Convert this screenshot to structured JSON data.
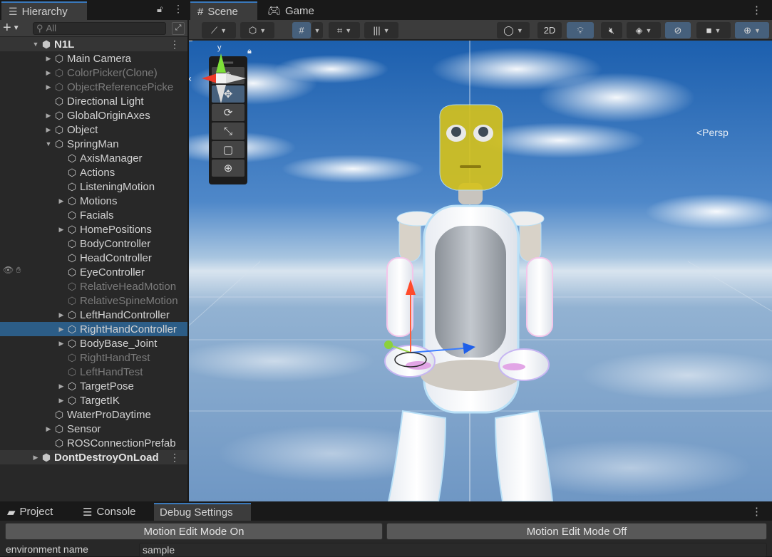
{
  "hierarchy": {
    "tab_label": "Hierarchy",
    "search_placeholder": "All",
    "add_label": "+",
    "rows": [
      {
        "label": "N1L",
        "type": "scene"
      },
      {
        "label": "Main Camera"
      },
      {
        "label": "ColorPicker(Clone)",
        "disabled": true
      },
      {
        "label": "ObjectReferencePicke",
        "disabled": true
      },
      {
        "label": "Directional Light"
      },
      {
        "label": "GlobalOriginAxes"
      },
      {
        "label": "Object"
      },
      {
        "label": "SpringMan"
      },
      {
        "label": "AxisManager"
      },
      {
        "label": "Actions"
      },
      {
        "label": "ListeningMotion"
      },
      {
        "label": "Motions"
      },
      {
        "label": "Facials"
      },
      {
        "label": "HomePositions"
      },
      {
        "label": "BodyController"
      },
      {
        "label": "HeadController"
      },
      {
        "label": "EyeController"
      },
      {
        "label": "RelativeHeadMotion",
        "disabled": true
      },
      {
        "label": "RelativeSpineMotion",
        "disabled": true
      },
      {
        "label": "LeftHandController"
      },
      {
        "label": "RightHandController",
        "selected": true
      },
      {
        "label": "BodyBase_Joint"
      },
      {
        "label": "RightHandTest",
        "disabled": true
      },
      {
        "label": "LeftHandTest",
        "disabled": true
      },
      {
        "label": "TargetPose"
      },
      {
        "label": "TargetIK"
      },
      {
        "label": "WaterProDaytime"
      },
      {
        "label": "Sensor"
      },
      {
        "label": "ROSConnectionPrefab"
      },
      {
        "label": "DontDestroyOnLoad",
        "type": "scene"
      }
    ]
  },
  "scene": {
    "tabs": {
      "scene": "Scene",
      "game": "Game"
    },
    "toolbar": {
      "mode_2d": "2D"
    },
    "gizmo": {
      "x": "x",
      "y": "y",
      "persp": "<Persp"
    }
  },
  "bottom": {
    "tabs": {
      "project": "Project",
      "console": "Console",
      "debug": "Debug Settings"
    },
    "motion_on": "Motion Edit Mode On",
    "motion_off": "Motion Edit Mode Off",
    "env_label": "environment name",
    "env_value": "sample"
  },
  "colors": {
    "accent": "#3a79bb",
    "selection": "#2c5d87",
    "panel": "#282828"
  }
}
